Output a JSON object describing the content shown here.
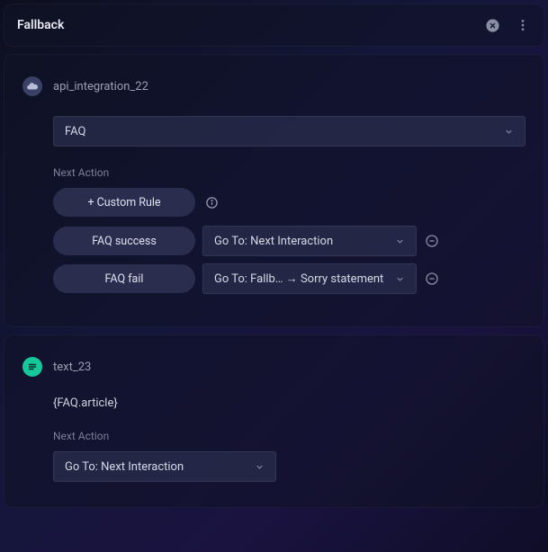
{
  "header": {
    "title": "Fallback"
  },
  "node1": {
    "title": "api_integration_22",
    "mainSelect": "FAQ",
    "nextActionLabel": "Next Action",
    "customRuleBtn": "+ Custom Rule",
    "rules": [
      {
        "condition": "FAQ success",
        "action": "Go To: Next Interaction"
      },
      {
        "condition": "FAQ fail",
        "action": "Go To: Fallb… → Sorry statement"
      }
    ]
  },
  "node2": {
    "title": "text_23",
    "content": "{FAQ.article}",
    "nextActionLabel": "Next Action",
    "actionSelect": "Go To: Next Interaction"
  }
}
